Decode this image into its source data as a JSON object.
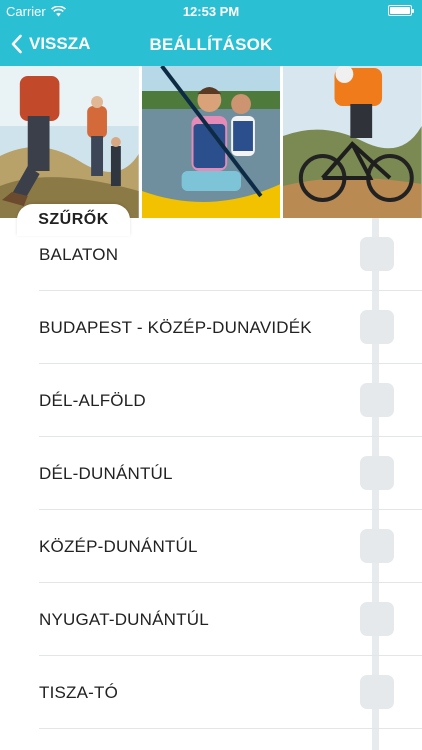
{
  "status_bar": {
    "carrier": "Carrier",
    "time": "12:53 PM"
  },
  "nav": {
    "back_label": "VISSZA",
    "title": "BEÁLLÍTÁSOK"
  },
  "photos": [
    {
      "name": "hiking-photo"
    },
    {
      "name": "kayaking-photo"
    },
    {
      "name": "cycling-photo"
    }
  ],
  "filters": {
    "tab_label": "SZŰRŐK"
  },
  "regions": [
    {
      "label": "BALATON",
      "checked": false
    },
    {
      "label": "BUDAPEST - KÖZÉP-DUNAVIDÉK",
      "checked": false
    },
    {
      "label": "DÉL-ALFÖLD",
      "checked": false
    },
    {
      "label": "DÉL-DUNÁNTÚL",
      "checked": false
    },
    {
      "label": "KÖZÉP-DUNÁNTÚL",
      "checked": false
    },
    {
      "label": "NYUGAT-DUNÁNTÚL",
      "checked": false
    },
    {
      "label": "TISZA-TÓ",
      "checked": false
    }
  ],
  "colors": {
    "accent": "#2bbfd3",
    "checkbox": "#e6e9ec",
    "rail": "#e8ebee"
  }
}
